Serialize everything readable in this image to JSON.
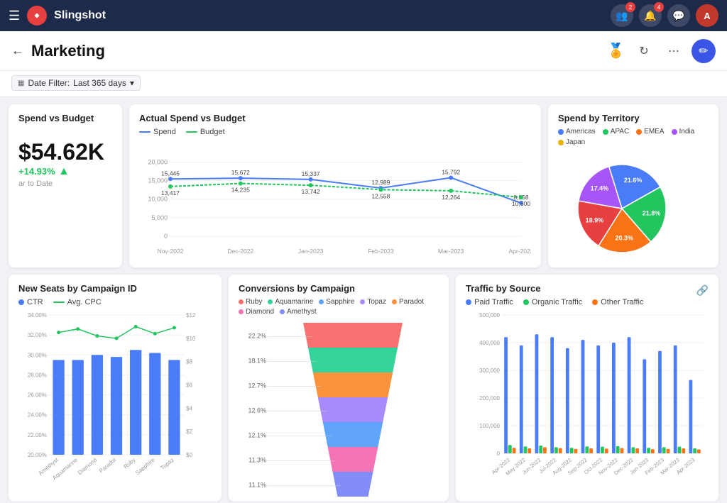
{
  "app": {
    "name": "Slingshot"
  },
  "nav": {
    "notifications_count": "4",
    "avatar_initials": "A"
  },
  "header": {
    "title": "Marketing",
    "back_label": "←",
    "refresh_title": "Refresh",
    "more_title": "More",
    "edit_title": "Edit"
  },
  "filter": {
    "label": "Date Filter:",
    "value": "Last 365 days"
  },
  "spend_vs_budget": {
    "title": "Spend vs Budget",
    "value": "$54.62K",
    "change": "+14.93%",
    "sub": "ar to Date"
  },
  "actual_spend": {
    "title": "Actual Spend vs Budget",
    "legend": [
      {
        "label": "Spend",
        "color": "#4a7cf7"
      },
      {
        "label": "Budget",
        "color": "#22c55e"
      }
    ],
    "months": [
      "Nov-2022",
      "Dec-2022",
      "Jan-2023",
      "Feb-2023",
      "Mar-2023",
      "Apr-2023"
    ],
    "spend": [
      15445,
      15672,
      15337,
      12989,
      15792,
      8958
    ],
    "budget": [
      13417,
      14235,
      13742,
      12558,
      12264,
      10500
    ]
  },
  "territory": {
    "title": "Spend by Territory",
    "legend": [
      {
        "label": "Americas",
        "color": "#4a7cf7"
      },
      {
        "label": "APAC",
        "color": "#22c55e"
      },
      {
        "label": "EMEA",
        "color": "#f97316"
      },
      {
        "label": "India",
        "color": "#a855f7"
      },
      {
        "label": "Japan",
        "color": "#eab308"
      }
    ],
    "slices": [
      {
        "label": "21.6%",
        "value": 21.6,
        "color": "#4a7cf7"
      },
      {
        "label": "21.8%",
        "value": 21.8,
        "color": "#22c55e"
      },
      {
        "label": "20.3%",
        "value": 20.3,
        "color": "#f97316"
      },
      {
        "label": "18.9%",
        "value": 18.9,
        "color": "#e84040"
      },
      {
        "label": "17.4%",
        "value": 17.4,
        "color": "#a855f7"
      }
    ]
  },
  "new_seats": {
    "title": "New Seats by Campaign ID",
    "legend": [
      {
        "label": "CTR",
        "color": "#4a7cf7"
      },
      {
        "label": "Avg. CPC",
        "color": "#22c55e"
      }
    ],
    "categories": [
      "Amethyst",
      "Aquamarine",
      "Diamond",
      "Paradot",
      "Ruby",
      "Sapphire",
      "Topaz"
    ],
    "ctr": [
      29.5,
      29.5,
      30.0,
      29.8,
      30.5,
      30.2,
      29.5
    ],
    "avg_cpc": [
      10.5,
      10.8,
      10.2,
      10.0,
      11.0,
      10.4,
      10.9
    ]
  },
  "conversions": {
    "title": "Conversions by Campaign",
    "legend": [
      {
        "label": "Ruby",
        "color": "#f87171"
      },
      {
        "label": "Aquamarine",
        "color": "#34d399"
      },
      {
        "label": "Sapphire",
        "color": "#60a5fa"
      },
      {
        "label": "Topaz",
        "color": "#a78bfa"
      },
      {
        "label": "Paradot",
        "color": "#fb923c"
      },
      {
        "label": "Diamond",
        "color": "#f472b6"
      },
      {
        "label": "Amethyst",
        "color": "#818cf8"
      }
    ],
    "funnel": [
      {
        "label": "22.2%",
        "value": 100,
        "color": "#f87171"
      },
      {
        "label": "18.1%",
        "value": 80,
        "color": "#34d399"
      },
      {
        "label": "12.7%",
        "value": 62,
        "color": "#fb923c"
      },
      {
        "label": "12.6%",
        "value": 55,
        "color": "#a78bfa"
      },
      {
        "label": "12.1%",
        "value": 48,
        "color": "#60a5fa"
      },
      {
        "label": "11.3%",
        "value": 42,
        "color": "#f472b6"
      },
      {
        "label": "11.1%",
        "value": 36,
        "color": "#818cf8"
      }
    ]
  },
  "traffic": {
    "title": "Traffic by Source",
    "legend": [
      {
        "label": "Paid Traffic",
        "color": "#4a7cf7"
      },
      {
        "label": "Organic Traffic",
        "color": "#22c55e"
      },
      {
        "label": "Other Traffic",
        "color": "#f97316"
      }
    ],
    "months": [
      "Apr-2022",
      "May-2022",
      "Jun-2022",
      "Jul-2022",
      "Aug-2022",
      "Sep-2022",
      "Oct-2022",
      "Nov-2022",
      "Dec-2022",
      "Jan-2023",
      "Feb-2023",
      "Mar-2023",
      "Apr-2023"
    ],
    "paid": [
      420000,
      390000,
      430000,
      420000,
      380000,
      410000,
      390000,
      400000,
      420000,
      340000,
      370000,
      390000,
      265000
    ],
    "organic": [
      30000,
      25000,
      28000,
      22000,
      20000,
      25000,
      24000,
      26000,
      22000,
      20000,
      22000,
      24000,
      18000
    ],
    "other": [
      20000,
      18000,
      22000,
      19000,
      16000,
      18000,
      17000,
      19000,
      18000,
      15000,
      16000,
      18000,
      14000
    ]
  }
}
